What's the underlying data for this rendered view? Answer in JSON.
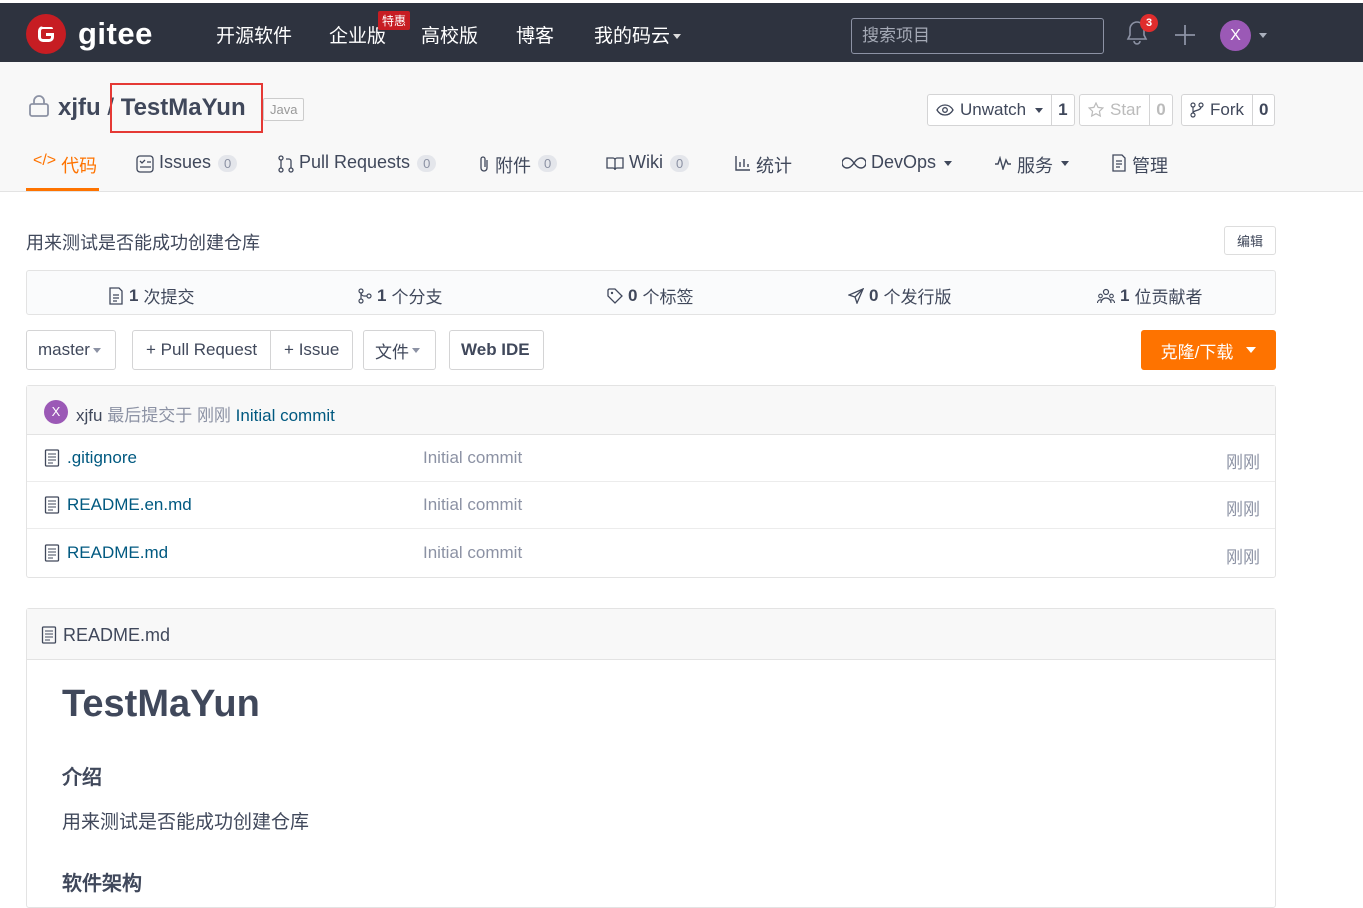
{
  "nav": {
    "logo_text": "gitee",
    "links": [
      "开源软件",
      "企业版",
      "高校版",
      "博客",
      "我的码云"
    ],
    "hot_badge": "特惠",
    "search_placeholder": "搜索项目",
    "notification_count": "3",
    "avatar_letter": "X"
  },
  "repo": {
    "owner": "xjfu",
    "separator": "/",
    "name": "TestMaYun",
    "language": "Java",
    "watch": {
      "label": "Unwatch",
      "count": "1"
    },
    "star": {
      "label": "Star",
      "count": "0"
    },
    "fork": {
      "label": "Fork",
      "count": "0"
    }
  },
  "tabs": [
    {
      "label": "代码",
      "icon": "code-icon"
    },
    {
      "label": "Issues",
      "count": "0",
      "icon": "issues-icon"
    },
    {
      "label": "Pull Requests",
      "count": "0",
      "icon": "pull-request-icon"
    },
    {
      "label": "附件",
      "count": "0",
      "icon": "attachment-icon"
    },
    {
      "label": "Wiki",
      "count": "0",
      "icon": "wiki-icon"
    },
    {
      "label": "统计",
      "icon": "chart-icon"
    },
    {
      "label": "DevOps",
      "icon": "devops-icon"
    },
    {
      "label": "服务",
      "icon": "service-icon"
    },
    {
      "label": "管理",
      "icon": "manage-icon"
    }
  ],
  "description": "用来测试是否能成功创建仓库",
  "edit_label": "编辑",
  "stats": [
    {
      "count": "1",
      "label": "次提交"
    },
    {
      "count": "1",
      "label": "个分支"
    },
    {
      "count": "0",
      "label": "个标签"
    },
    {
      "count": "0",
      "label": "个发行版"
    },
    {
      "count": "1",
      "label": "位贡献者"
    }
  ],
  "toolbar": {
    "branch": "master",
    "pull_request": "+ Pull Request",
    "issue": "+ Issue",
    "file": "文件",
    "web_ide": "Web IDE",
    "clone": "克隆/下载"
  },
  "last_commit": {
    "avatar": "X",
    "author": "xjfu",
    "text": "最后提交于",
    "time": "刚刚",
    "message": "Initial commit"
  },
  "files": [
    {
      "name": ".gitignore",
      "message": "Initial commit",
      "time": "刚刚"
    },
    {
      "name": "README.en.md",
      "message": "Initial commit",
      "time": "刚刚"
    },
    {
      "name": "README.md",
      "message": "Initial commit",
      "time": "刚刚"
    }
  ],
  "readme": {
    "filename": "README.md",
    "title": "TestMaYun",
    "h_intro": "介绍",
    "intro": "用来测试是否能成功创建仓库",
    "h_arch": "软件架构"
  },
  "colors": {
    "accent": "#fe7300",
    "navbar": "#2e333f",
    "brand_red": "#c71d23",
    "link": "#005980",
    "highlight": "#e53935"
  }
}
